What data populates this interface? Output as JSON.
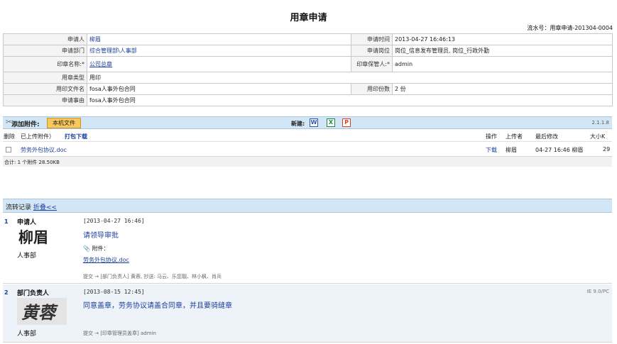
{
  "page": {
    "title": "用章申请",
    "serial_label": "流水号：用章申请-201304-0004"
  },
  "form": {
    "applicant_label": "申请人",
    "applicant_value": "柳眉",
    "apply_time_label": "申请时间",
    "apply_time_value": "2013-04-27 16:46:13",
    "dept_label": "申请部门",
    "dept_value": "综合管理部\\人事部",
    "position_label": "申请岗位",
    "position_value": "岗位_信息发布管理员, 岗位_行政外勤",
    "seal_name_label": "印章名称:*",
    "seal_name_value": "公司总章",
    "seal_keeper_label": "印章保管人:*",
    "seal_keeper_value": "admin",
    "seal_type_label": "用章类型",
    "seal_type_value": "用印",
    "doc_name_label": "用印文件名",
    "doc_name_value": "fosa人事外包合同",
    "copies_label": "用印份数",
    "copies_value": "2 份",
    "reason_label": "申请事由",
    "reason_value": "fosa人事外包合同"
  },
  "attachments": {
    "add_label": "添加附件:",
    "local_file_button": "本机文件",
    "new_label": "新建:",
    "new_word": "W",
    "new_excel": "X",
    "new_ppt": "P",
    "version": "2.1.1.8",
    "head_delete": "删除",
    "head_uploaded": "已上传附件）",
    "head_pack_download": "打包下载",
    "head_action": "操作",
    "head_uploader": "上传者",
    "head_modified": "最后修改",
    "head_size": "大小K",
    "rows": [
      {
        "name": "劳务外包协议.doc",
        "action": "下载",
        "uploader": "柳眉",
        "modified": "04-27 16:46 柳眉",
        "size": "29"
      }
    ],
    "total": "合计: 1 个附件 28.50KB"
  },
  "flow": {
    "title": "流转记录",
    "fold_label": "折叠<<",
    "records": [
      {
        "num": "1",
        "role": "申请人",
        "signature": "柳眉",
        "dept": "人事部",
        "time": "[2013-04-27 16:46]",
        "opinion": "请领导审批",
        "attach_label": "附件：",
        "attach_file": "劳务外包协议.doc",
        "submit": "提交 → [部门负责人] 黄蓉, 抄送: 马云、乐您靓、林小枫、肖兵"
      },
      {
        "num": "2",
        "role": "部门负责人",
        "signature": "黄蓉",
        "dept": "人事部",
        "time": "[2013-08-15 12:45]",
        "opinion": "同意盖章，劳务协议请盖合同章，并且要骑缝章",
        "submit": "提交 → [印章管理员盖章] admin",
        "ua": "IE 9.0/PC"
      }
    ]
  },
  "colors": {
    "bar": "#d3e6f5",
    "link": "#1a3e9a",
    "button": "#f7c85c"
  }
}
